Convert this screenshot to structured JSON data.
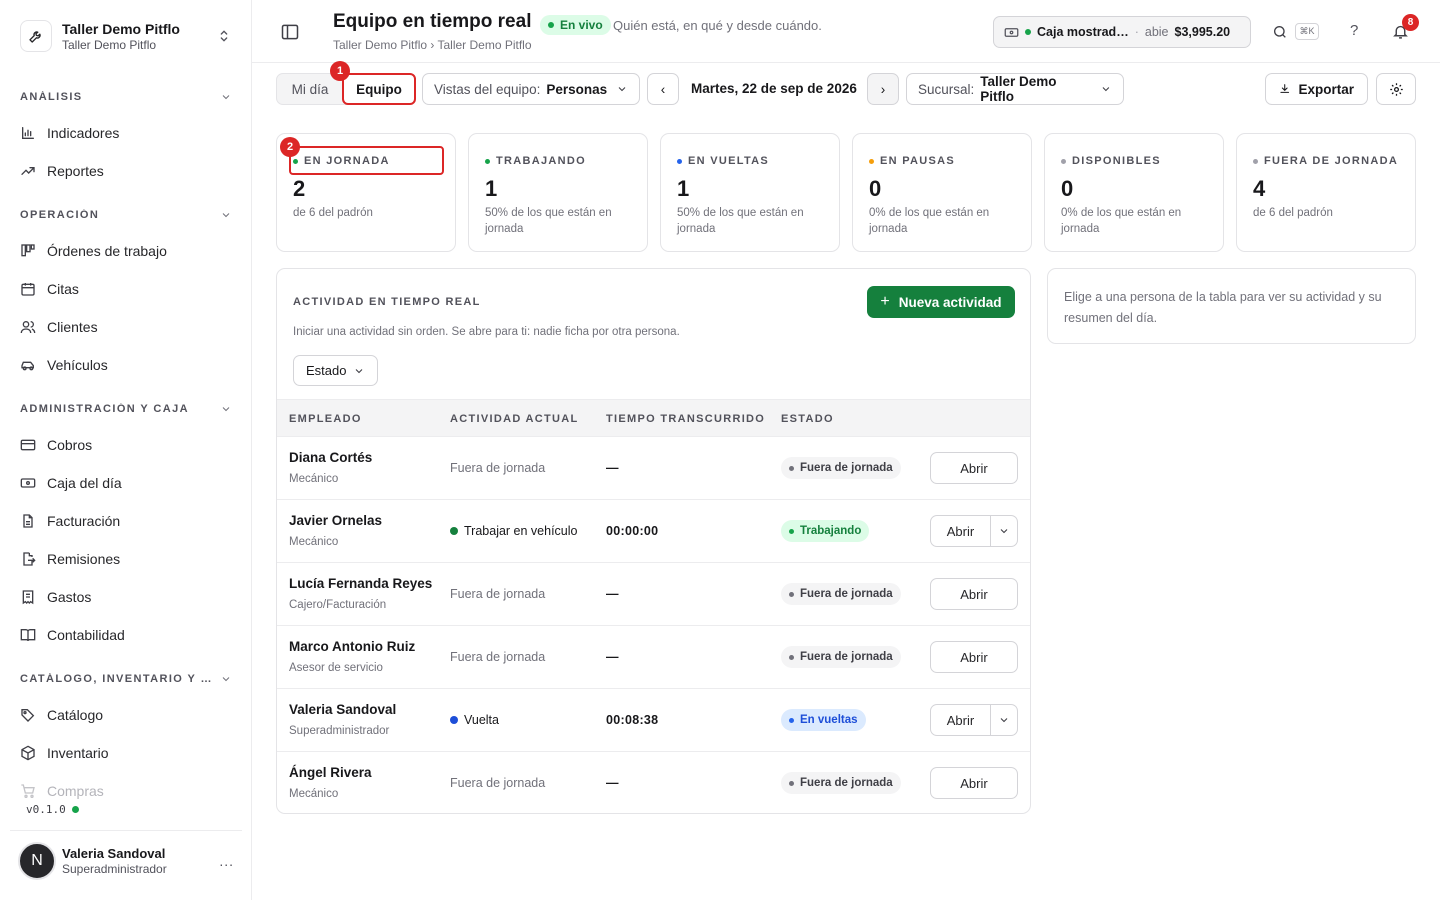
{
  "workspace": {
    "name": "Taller Demo Pitflo",
    "sub": "Taller Demo Pitflo"
  },
  "nav": {
    "sections": [
      {
        "title": "ANÁLISIS",
        "items": [
          "Indicadores",
          "Reportes"
        ]
      },
      {
        "title": "OPERACIÓN",
        "items": [
          "Órdenes de trabajo",
          "Citas",
          "Clientes",
          "Vehículos"
        ]
      },
      {
        "title": "ADMINISTRACIÓN Y CAJA",
        "items": [
          "Cobros",
          "Caja del día",
          "Facturación",
          "Remisiones",
          "Gastos",
          "Contabilidad"
        ]
      },
      {
        "title": "CATÁLOGO, INVENTARIO Y CO…",
        "items": [
          "Catálogo",
          "Inventario",
          "Compras"
        ]
      }
    ]
  },
  "version": "v0.1.0",
  "user": {
    "initial": "N",
    "name": "Valeria Sandoval",
    "role": "Superadministrador",
    "more": "..."
  },
  "header": {
    "title": "Equipo en tiempo real",
    "live": "En vivo",
    "subtitle": "Quién está, en qué y desde cuándo.",
    "breadcrumb": "Taller Demo Pitflo › Taller Demo Pitflo",
    "caja": {
      "name": "Caja mostrad…",
      "sep": "·",
      "state": "abie",
      "amount": "$3,995.20"
    },
    "kbd": "⌘K",
    "help": "?",
    "notif_count": "8"
  },
  "toolbar": {
    "tab_mi_dia": "Mi día",
    "tab_equipo": "Equipo",
    "vistas_label": "Vistas del equipo:",
    "vistas_value": "Personas",
    "prev": "‹",
    "date": "Martes, 22 de sep de 2026",
    "next": "›",
    "sucursal_label": "Sucursal:",
    "sucursal_value": "Taller Demo Pitflo",
    "export": "Exportar"
  },
  "markers": {
    "m1": "1",
    "m2": "2"
  },
  "kpis": [
    {
      "label": "EN JORNADA",
      "value": "2",
      "sub": "de 6 del padrón",
      "color": "#16a34a"
    },
    {
      "label": "TRABAJANDO",
      "value": "1",
      "sub": "50% de los que están en jornada",
      "color": "#16a34a"
    },
    {
      "label": "EN VUELTAS",
      "value": "1",
      "sub": "50% de los que están en jornada",
      "color": "#2563eb"
    },
    {
      "label": "EN PAUSAS",
      "value": "0",
      "sub": "0% de los que están en jornada",
      "color": "#f59e0b"
    },
    {
      "label": "DISPONIBLES",
      "value": "0",
      "sub": "0% de los que están en jornada",
      "color": "#a1a1aa"
    },
    {
      "label": "FUERA DE JORNADA",
      "value": "4",
      "sub": "de 6 del padrón",
      "color": "#a1a1aa"
    }
  ],
  "activity": {
    "title": "ACTIVIDAD EN TIEMPO REAL",
    "desc": "Iniciar una actividad sin orden. Se abre para ti: nadie ficha por otra persona.",
    "new_button": "Nueva actividad",
    "new_plus": "+",
    "filter": "Estado",
    "columns": [
      "EMPLEADO",
      "ACTIVIDAD ACTUAL",
      "TIEMPO TRANSCURRIDO",
      "ESTADO"
    ],
    "rows": [
      {
        "name": "Diana Cortés",
        "role": "Mecánico",
        "activity": "Fuera de jornada",
        "time": "—",
        "status": "Fuera de jornada",
        "action": "Abrir"
      },
      {
        "name": "Javier Ornelas",
        "role": "Mecánico",
        "activity": "Trabajar en vehículo",
        "time": "00:00:00",
        "status": "Trabajando",
        "action": "Abrir"
      },
      {
        "name": "Lucía Fernanda Reyes",
        "role": "Cajero/Facturación",
        "activity": "Fuera de jornada",
        "time": "—",
        "status": "Fuera de jornada",
        "action": "Abrir"
      },
      {
        "name": "Marco Antonio Ruiz",
        "role": "Asesor de servicio",
        "activity": "Fuera de jornada",
        "time": "—",
        "status": "Fuera de jornada",
        "action": "Abrir"
      },
      {
        "name": "Valeria Sandoval",
        "role": "Superadministrador",
        "activity": "Vuelta",
        "time": "00:08:38",
        "status": "En vueltas",
        "action": "Abrir"
      },
      {
        "name": "Ángel Rivera",
        "role": "Mecánico",
        "activity": "Fuera de jornada",
        "time": "—",
        "status": "Fuera de jornada",
        "action": "Abrir"
      }
    ]
  },
  "side_panel": {
    "hint": "Elige a una persona de la tabla para ver su actividad y su resumen del día."
  }
}
